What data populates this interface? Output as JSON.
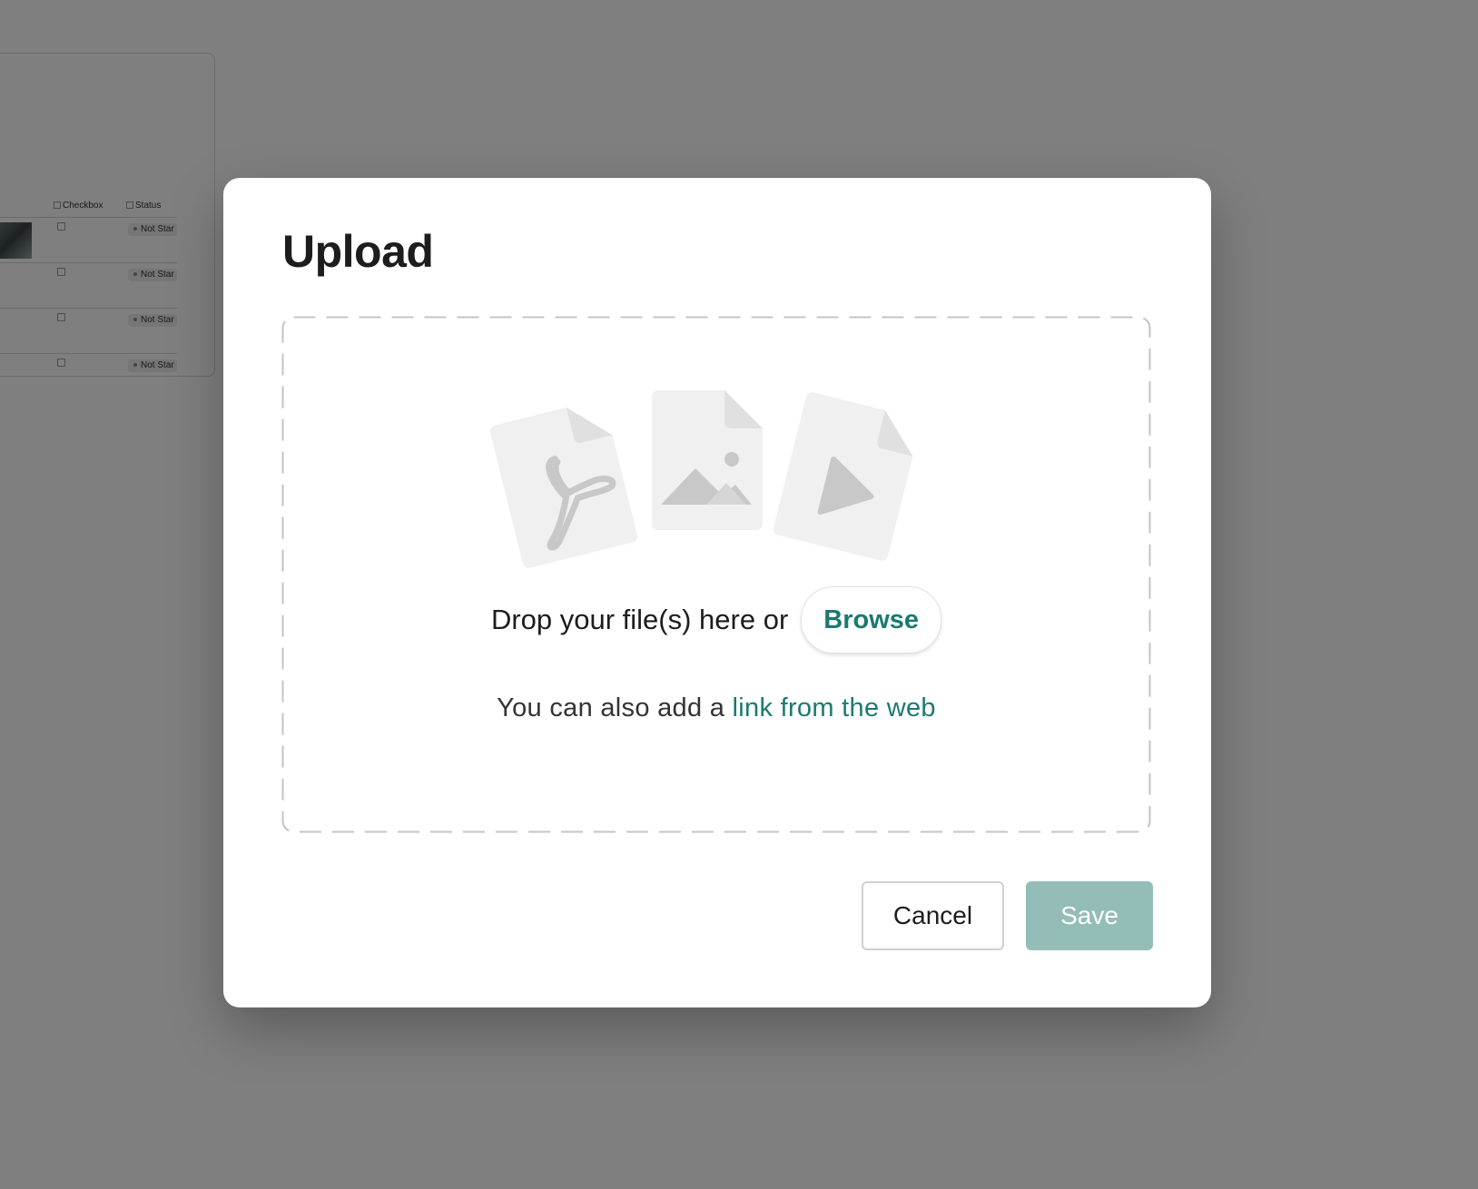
{
  "background": {
    "columns": {
      "checkbox": "Checkbox",
      "status": "Status"
    },
    "rows": [
      {
        "status": "Not Star"
      },
      {
        "status": "Not Star"
      },
      {
        "status": "Not Star"
      },
      {
        "status": "Not Star"
      }
    ]
  },
  "modal": {
    "title": "Upload",
    "drop_text": "Drop your file(s) here or",
    "browse_label": "Browse",
    "link_prefix": "You can also add a",
    "link_text": "link from the web",
    "cancel_label": "Cancel",
    "save_label": "Save",
    "icons": [
      "pdf-file-icon",
      "image-file-icon",
      "video-file-icon"
    ],
    "colors": {
      "accent": "#1b7a70",
      "save_disabled": "#93bdb6"
    }
  }
}
